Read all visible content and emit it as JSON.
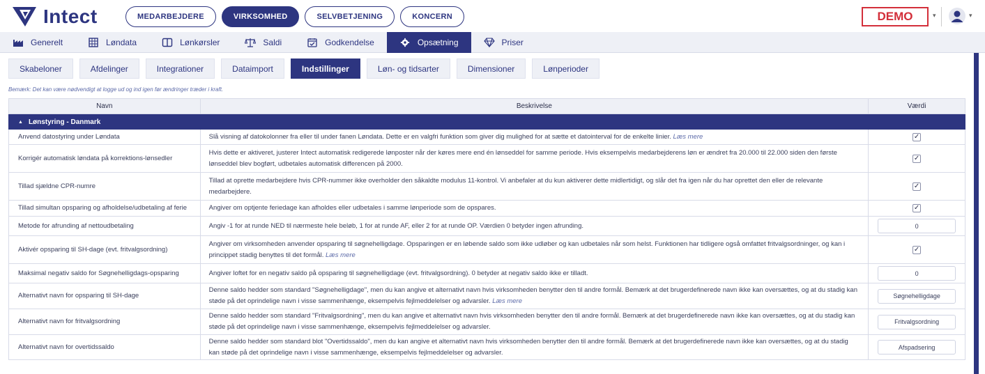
{
  "brand": {
    "name": "Intect"
  },
  "topnav": [
    "MEDARBEJDERE",
    "VIRKSOMHED",
    "SELVBETJENING",
    "KONCERN"
  ],
  "demo_label": "DEMO",
  "maintabs": [
    "Generelt",
    "Løndata",
    "Lønkørsler",
    "Saldi",
    "Godkendelse",
    "Opsætning",
    "Priser"
  ],
  "subtabs": [
    "Skabeloner",
    "Afdelinger",
    "Integrationer",
    "Dataimport",
    "Indstillinger",
    "Løn- og tidsarter",
    "Dimensioner",
    "Lønperioder"
  ],
  "note": "Bemærk: Det kan være nødvendigt at logge ud og ind igen før ændringer træder i kraft.",
  "table": {
    "headers": [
      "Navn",
      "Beskrivelse",
      "Værdi"
    ],
    "group": "Lønstyring - Danmark",
    "rows": [
      {
        "name": "Anvend datostyring under Løndata",
        "desc": "Slå visning af datokolonner fra eller til under fanen Løndata. Dette er en valgfri funktion som giver dig mulighed for at sætte et datointerval for de enkelte linier.",
        "more": "Læs mere",
        "check": "✓"
      },
      {
        "name": "Korrigér automatisk løndata på korrektions-lønsedler",
        "desc": "Hvis dette er aktiveret, justerer Intect automatisk redigerede lønposter når der køres mere end én lønseddel for samme periode. Hvis eksempelvis medarbejderens løn er ændret fra 20.000 til 22.000 siden den første lønseddel blev bogført, udbetales automatisk differencen på 2000.",
        "more": "",
        "check": "✓"
      },
      {
        "name": "Tillad sjældne CPR-numre",
        "desc": "Tillad at oprette medarbejdere hvis CPR-nummer ikke overholder den såkaldte modulus 11-kontrol. Vi anbefaler at du kun aktiverer dette midlertidigt, og slår det fra igen når du har oprettet den eller de relevante medarbejdere.",
        "more": "",
        "check": "✓"
      },
      {
        "name": "Tillad simultan opsparing og afholdelse/udbetaling af ferie",
        "desc": "Angiver om optjente feriedage kan afholdes eller udbetales i samme lønperiode som de opspares.",
        "more": "",
        "check": "✓"
      },
      {
        "name": "Metode for afrunding af nettoudbetaling",
        "desc": "Angiv -1 for at runde NED til nærmeste hele beløb, 1 for at runde AF, eller 2 for at runde OP. Værdien 0 betyder ingen afrunding.",
        "more": "",
        "value": "0"
      },
      {
        "name": "Aktivér opsparing til SH-dage (evt. fritvalgsordning)",
        "desc": "Angiver om virksomheden anvender opsparing til søgnehelligdage. Opsparingen er en løbende saldo som ikke udløber og kan udbetales når som helst. Funktionen har tidligere også omfattet fritvalgsordninger, og kan i princippet stadig benyttes til det formål.",
        "more": "Læs mere",
        "check": "✓"
      },
      {
        "name": "Maksimal negativ saldo for Søgnehelligdags-opsparing",
        "desc": "Angiver loftet for en negativ saldo på opsparing til søgnehelligdage (evt. fritvalgsordning). 0 betyder at negativ saldo ikke er tilladt.",
        "more": "",
        "value": "0"
      },
      {
        "name": "Alternativt navn for opsparing til SH-dage",
        "desc": "Denne saldo hedder som standard \"Søgnehelligdage\", men du kan angive et alternativt navn hvis virksomheden benytter den til andre formål. Bemærk at det brugerdefinerede navn ikke kan oversættes, og at du stadig kan støde på det oprindelige navn i visse sammenhænge, eksempelvis fejlmeddelelser og advarsler.",
        "more": "Læs mere",
        "value": "Søgnehelligdage"
      },
      {
        "name": "Alternativt navn for fritvalgsordning",
        "desc": "Denne saldo hedder som standard \"Fritvalgsordning\", men du kan angive et alternativt navn hvis virksomheden benytter den til andre formål. Bemærk at det brugerdefinerede navn ikke kan oversættes, og at du stadig kan støde på det oprindelige navn i visse sammenhænge, eksempelvis fejlmeddelelser og advarsler.",
        "more": "",
        "value": "Fritvalgsordning"
      },
      {
        "name": "Alternativt navn for overtidssaldo",
        "desc": "Denne saldo hedder som standard blot \"Overtidssaldo\", men du kan angive et alternativt navn hvis virksomheden benytter den til andre formål. Bemærk at det brugerdefinerede navn ikke kan oversættes, og at du stadig kan støde på det oprindelige navn i visse sammenhænge, eksempelvis fejlmeddelelser og advarsler.",
        "more": "",
        "value": "Afspadsering"
      }
    ]
  },
  "colors": {
    "primary": "#2d3580",
    "demo": "#d32f3a",
    "tabbg": "#eef0f6"
  }
}
